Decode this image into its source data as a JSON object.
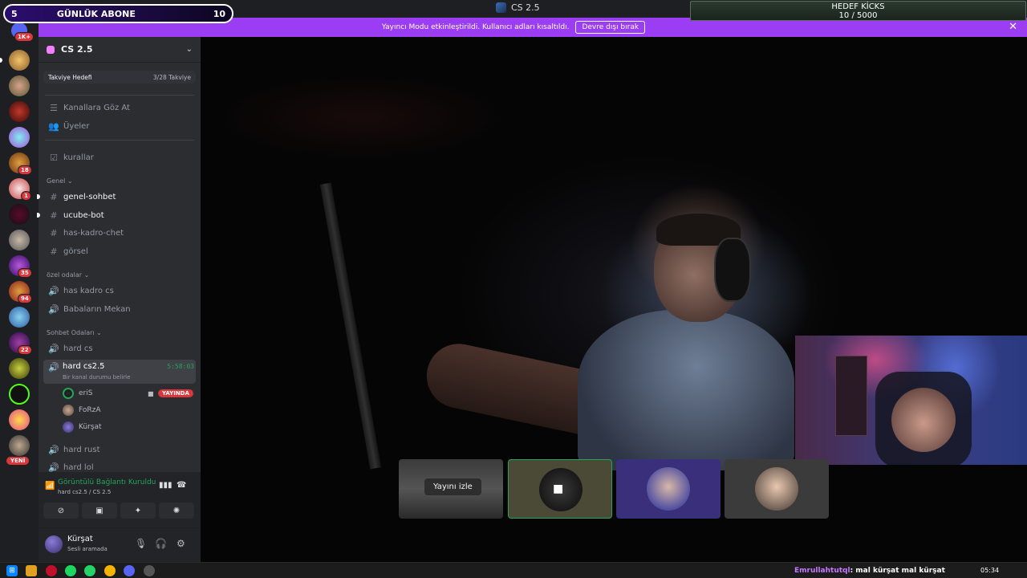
{
  "window": {
    "title": "CS 2.5"
  },
  "overlay": {
    "subs": {
      "left_count": "5",
      "label": "GÜNLÜK ABONE",
      "right_count": "10"
    },
    "kicks": {
      "title": "HEDEF KİCKS",
      "progress": "10 / 5000"
    }
  },
  "notice": {
    "text": "Yayıncı Modu etkinleştirildi. Kullanıcı adları kısaltıldı.",
    "button": "Devre dışı bırak"
  },
  "rail": {
    "badges": [
      "1K+",
      "18",
      "1",
      "35",
      "94",
      "22"
    ],
    "new_label": "YENİ"
  },
  "server": {
    "name": "CS 2.5",
    "boost_goal": "Takviye Hedefi",
    "boost_progress": "3/28 Takviye"
  },
  "sidebar": {
    "browse": "Kanallara Göz At",
    "members": "Üyeler",
    "rules": "kurallar",
    "categories": [
      "Genel",
      "özel odalar",
      "Sohbet Odaları"
    ],
    "text_channels": [
      "genel-sohbet",
      "ucube-bot",
      "has-kadro-chet",
      "görsel"
    ],
    "private_rooms": [
      "has kadro cs",
      "Babaların Mekan"
    ],
    "voice_rooms": [
      "hard cs",
      "hard cs2.5",
      "hard rust",
      "hard lol"
    ],
    "active_channel": {
      "name": "hard cs2.5",
      "status": "Bir kanal durumu belirle",
      "timer": "5:58:03"
    },
    "voice_members": [
      "eriS",
      "FoRzA",
      "Kürşat"
    ],
    "live_label": "YAYINDA"
  },
  "voice_panel": {
    "title": "Görüntülü Bağlantı Kuruldu",
    "subtitle": "hard cs2.5 / CS 2.5"
  },
  "user": {
    "name": "Kürşat",
    "status": "Sesli aramada"
  },
  "stage": {
    "watch_label": "Yayını izle"
  },
  "taskbar": {
    "chat_user": "Emrullahtutql",
    "chat_text": ": mal kürşat mal kürşat",
    "time": "05:34"
  }
}
